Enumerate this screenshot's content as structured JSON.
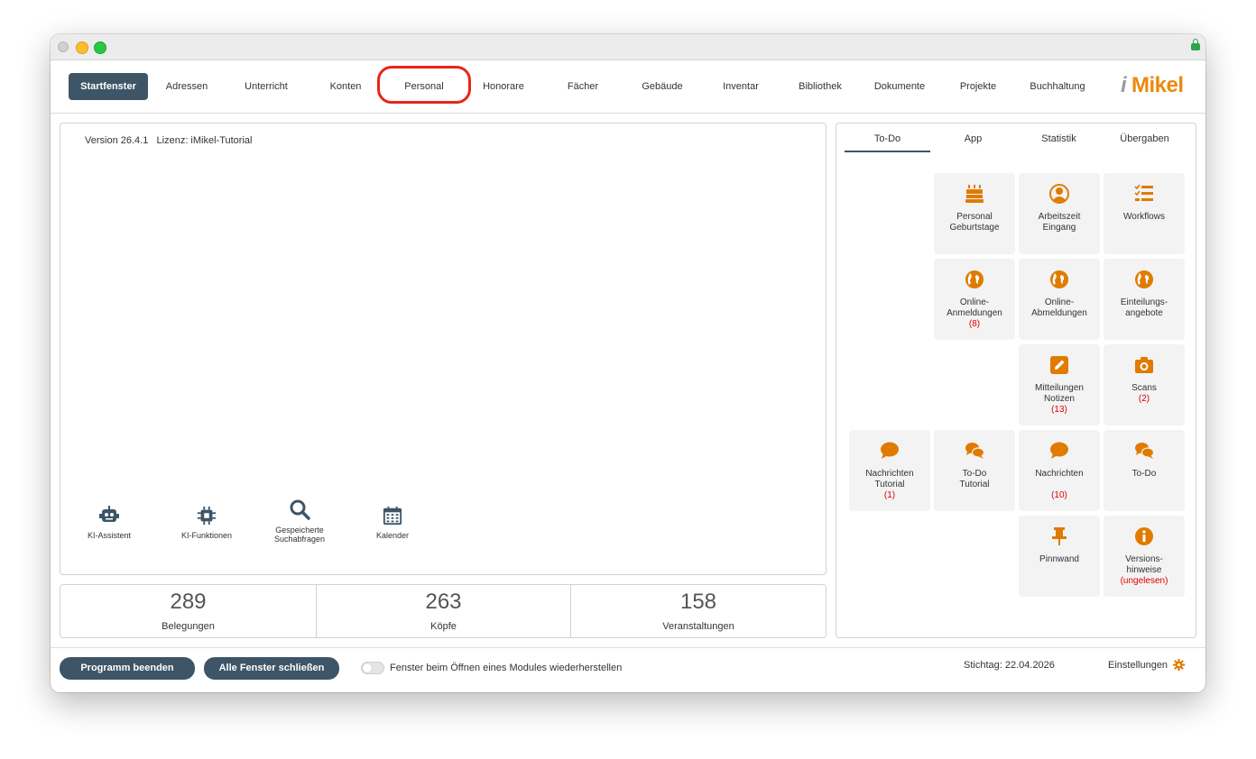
{
  "nav": {
    "items": [
      "Startfenster",
      "Adressen",
      "Unterricht",
      "Konten",
      "Personal",
      "Honorare",
      "Fächer",
      "Gebäude",
      "Inventar",
      "Bibliothek",
      "Dokumente",
      "Projekte",
      "Buchhaltung"
    ],
    "active": "Startfenster",
    "highlighted": "Personal"
  },
  "logo": {
    "i": "i",
    "text": "Mikel"
  },
  "main": {
    "version": "Version 26.4.1",
    "license": "Lizenz: iMikel-Tutorial",
    "tools": [
      {
        "label": "KI-Assistent",
        "icon": "robot-icon"
      },
      {
        "label": "KI-Funktionen",
        "icon": "chip-icon"
      },
      {
        "label": "Gespeicherte",
        "label2": "Suchabfragen",
        "icon": "search-icon"
      },
      {
        "label": "Kalender",
        "icon": "calendar-icon"
      }
    ]
  },
  "stats": [
    {
      "value": "289",
      "label": "Belegungen"
    },
    {
      "value": "263",
      "label": "Köpfe"
    },
    {
      "value": "158",
      "label": "Veranstaltungen"
    }
  ],
  "right": {
    "tabs": [
      "To-Do",
      "App",
      "Statistik",
      "Übergaben"
    ],
    "active_tab": "To-Do",
    "tiles": [
      {
        "line1": "Personal",
        "line2": "Geburtstage",
        "count": "",
        "icon": "cake-icon"
      },
      {
        "line1": "Arbeitszeit",
        "line2": "Eingang",
        "count": "",
        "icon": "user-icon"
      },
      {
        "line1": "Workflows",
        "line2": "",
        "count": "",
        "icon": "checklist-icon"
      },
      {
        "line1": "Online-",
        "line2": "Anmeldungen",
        "count": "(8)",
        "icon": "globe-icon"
      },
      {
        "line1": "Online-",
        "line2": "Abmeldungen",
        "count": "",
        "icon": "globe-icon"
      },
      {
        "line1": "Einteilungs-",
        "line2": "angebote",
        "count": "",
        "icon": "globe-icon"
      },
      {
        "line1": "Mitteilungen",
        "line2": "Notizen",
        "count": "(13)",
        "icon": "edit-icon"
      },
      {
        "line1": "Scans",
        "line2": "",
        "count": "(2)",
        "icon": "camera-icon"
      },
      {
        "line1": "Nachrichten",
        "line2": "Tutorial",
        "count": "(1)",
        "icon": "chat-icon"
      },
      {
        "line1": "To-Do",
        "line2": "Tutorial",
        "count": "",
        "icon": "chats-icon"
      },
      {
        "line1": "Nachrichten",
        "line2": "",
        "count": "(10)",
        "icon": "chat-icon"
      },
      {
        "line1": "To-Do",
        "line2": "",
        "count": "",
        "icon": "chats-icon"
      },
      {
        "line1": "Pinnwand",
        "line2": "",
        "count": "",
        "icon": "pin-icon"
      },
      {
        "line1": "Versions-",
        "line2": "hinweise",
        "count": "(ungelesen)",
        "icon": "info-icon"
      }
    ]
  },
  "footer": {
    "quit": "Programm beenden",
    "close_all": "Alle Fenster schließen",
    "toggle_label": "Fenster beim Öffnen eines Modules wiederherstellen",
    "toggle_on": false,
    "stichtag": "Stichtag: 22.04.2026",
    "settings": "Einstellungen"
  },
  "colors": {
    "accent": "#3d5566",
    "icon": "#e07b00",
    "highlight": "#e8251a",
    "count": "#e00000"
  }
}
